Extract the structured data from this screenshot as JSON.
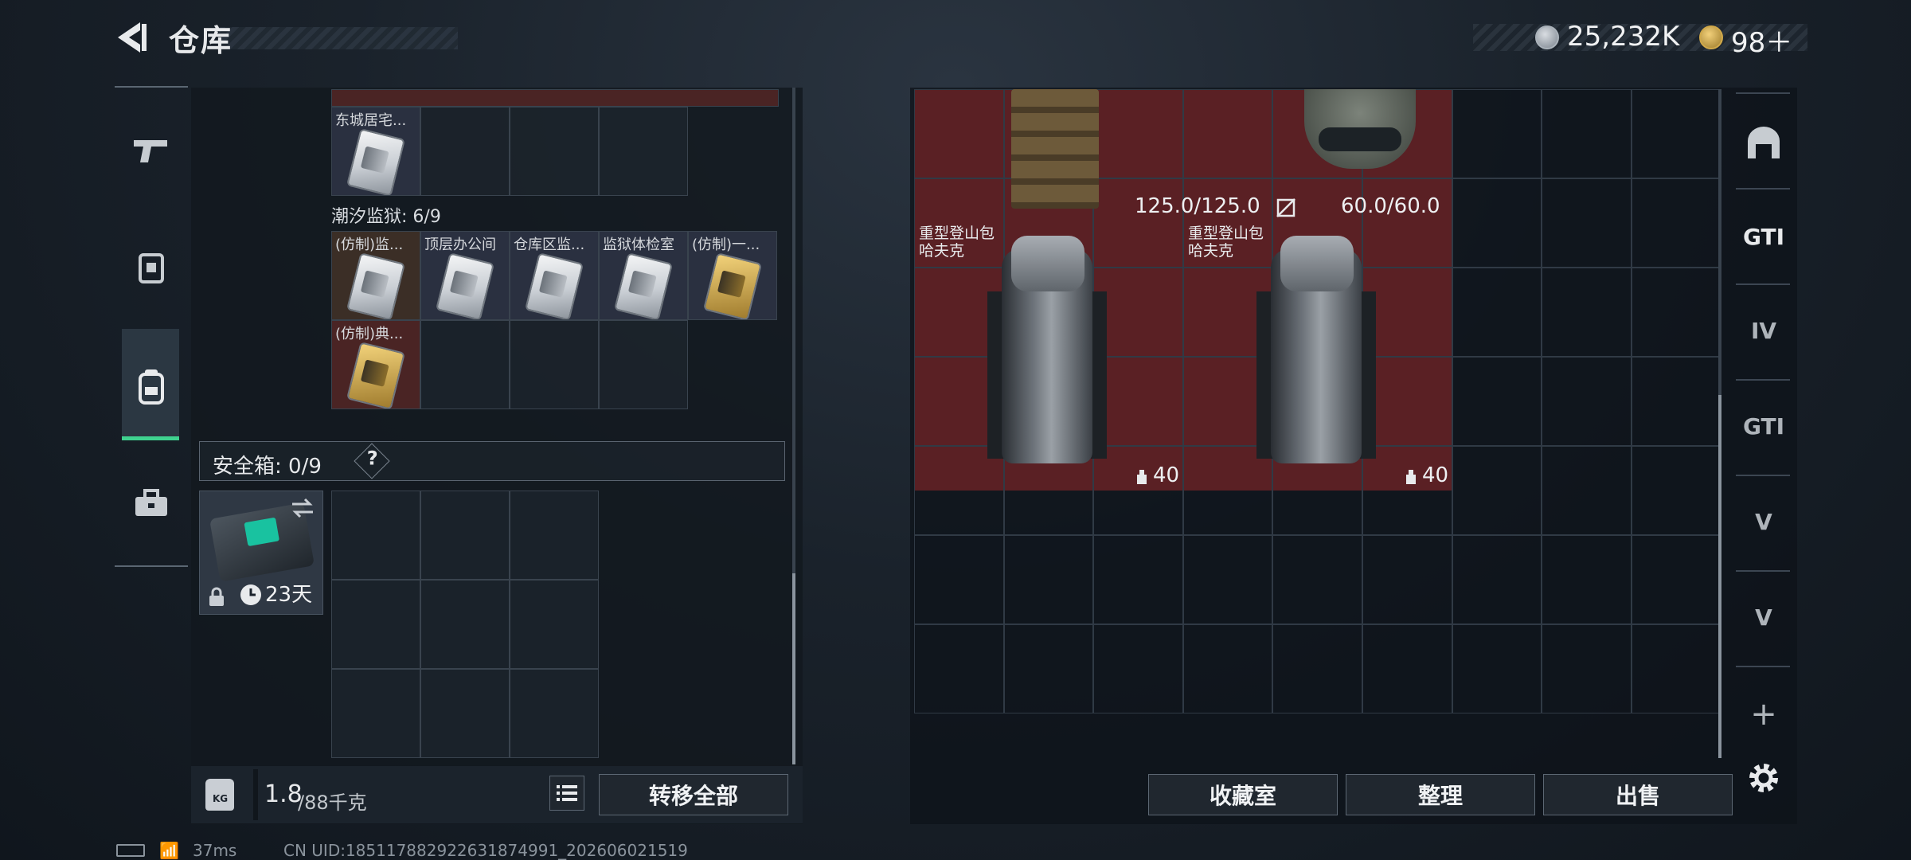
{
  "header": {
    "title": "仓库",
    "currency_silver": "25,232K",
    "currency_gold": "98＋"
  },
  "left_nav": {
    "items": [
      "weapons",
      "gear",
      "backpack",
      "toolbox"
    ],
    "active_index": 2
  },
  "left_panel": {
    "top_row_label": "东城居宅...",
    "section_title": "潮汐监狱: 6/9",
    "cards": [
      {
        "label": "(仿制)监...",
        "style": "brown"
      },
      {
        "label": "顶层办公间",
        "style": "normal"
      },
      {
        "label": "仓库区监...",
        "style": "normal"
      },
      {
        "label": "监狱体检室",
        "style": "normal"
      },
      {
        "label": "(仿制)一...",
        "style": "normal"
      },
      {
        "label": "(仿制)典...",
        "style": "red"
      }
    ],
    "safe_box": {
      "label": "安全箱: 0/9",
      "help": "?",
      "duration": "23天"
    },
    "weight": {
      "current": "1.8",
      "max": "/88千克"
    },
    "transfer_all_label": "转移全部"
  },
  "right_panel": {
    "armor_durability": "125.0/125.0",
    "helmet_durability": "60.0/60.0",
    "backpacks": [
      {
        "name_line1": "重型登山包",
        "name_line2": "哈夫克",
        "capacity": "40"
      },
      {
        "name_line1": "重型登山包",
        "name_line2": "哈夫克",
        "capacity": "40"
      }
    ],
    "buttons": {
      "collection": "收藏室",
      "organize": "整理",
      "sell": "出售"
    }
  },
  "right_sidebar": {
    "labels": [
      "GTI",
      "IV",
      "GTI",
      "V",
      "V"
    ],
    "add": "+"
  },
  "status_bar": {
    "ping": "37ms",
    "uid": "CN UID:185117882922631874991_202606021519"
  }
}
